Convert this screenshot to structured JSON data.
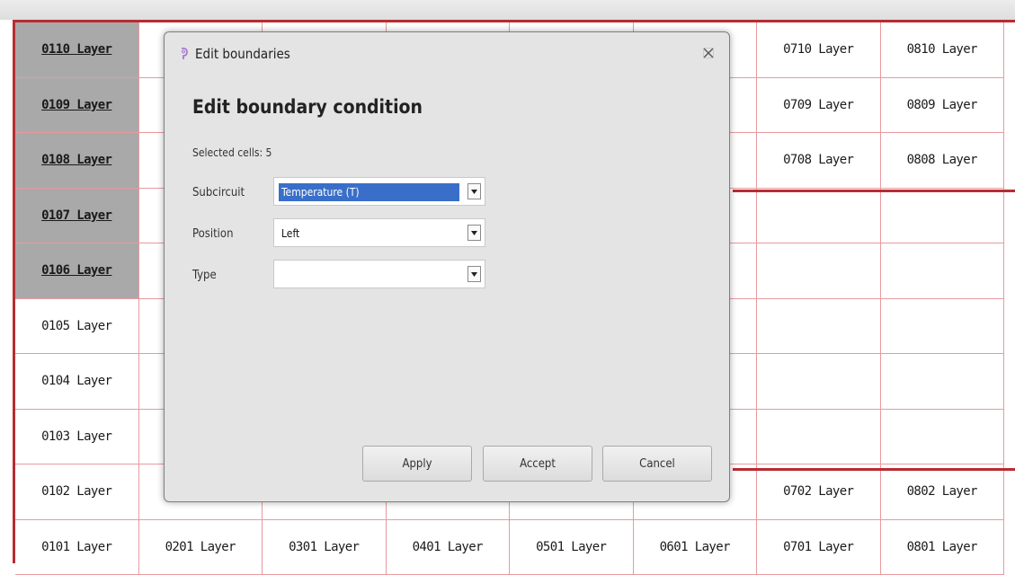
{
  "grid": {
    "rows": [
      [
        "0110 Layer",
        "",
        "",
        "",
        "",
        "",
        "0710 Layer",
        "0810 Layer"
      ],
      [
        "0109 Layer",
        "",
        "",
        "",
        "",
        "",
        "0709 Layer",
        "0809 Layer"
      ],
      [
        "0108 Layer",
        "",
        "",
        "",
        "",
        "",
        "0708 Layer",
        "0808 Layer"
      ],
      [
        "0107 Layer",
        "",
        "",
        "",
        "",
        "",
        "",
        ""
      ],
      [
        "0106 Layer",
        "",
        "",
        "",
        "",
        "",
        "",
        ""
      ],
      [
        "0105 Layer",
        "",
        "",
        "",
        "",
        "",
        "",
        ""
      ],
      [
        "0104 Layer",
        "",
        "",
        "",
        "",
        "",
        "",
        ""
      ],
      [
        "0103 Layer",
        "",
        "",
        "",
        "",
        "",
        "",
        ""
      ],
      [
        "0102 Layer",
        "",
        "",
        "",
        "",
        "",
        "0702 Layer",
        "0802 Layer"
      ],
      [
        "0101 Layer",
        "0201 Layer",
        "0301 Layer",
        "0401 Layer",
        "0501 Layer",
        "0601 Layer",
        "0701 Layer",
        "0801 Layer"
      ]
    ],
    "selected_rows": [
      0,
      1,
      2,
      3,
      4
    ]
  },
  "dialog": {
    "title": "Edit boundaries",
    "heading": "Edit boundary condition",
    "selected_cells": "Selected cells: 5",
    "subcircuit_label": "Subcircuit",
    "subcircuit_value": "Temperature (T)",
    "position_label": "Position",
    "position_value": "Left",
    "type_label": "Type",
    "type_value": "",
    "apply_label": "Apply",
    "accept_label": "Accept",
    "cancel_label": "Cancel"
  },
  "colors": {
    "grid_line": "#e89aa0",
    "thick_line": "#b72c33",
    "selected_cell": "#a9a9a9",
    "highlight": "#3a6fc9"
  },
  "icons": {
    "app_icon": "app-icon",
    "close_icon": "close-icon",
    "dropdown_icon": "chevron-down-icon"
  }
}
